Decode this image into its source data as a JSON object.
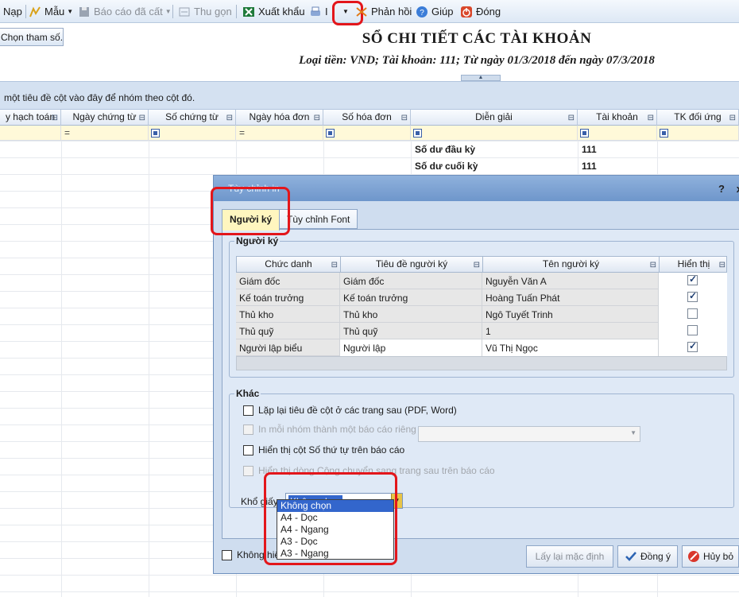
{
  "toolbar": {
    "nap": "Nạp",
    "mau": "Mẫu",
    "bao_cao_da_cat": "Báo cáo đã cất",
    "thu_gon": "Thu gọn",
    "xuat_khau": "Xuất khẩu",
    "in_label": "I",
    "phan_hoi": "Phản hồi",
    "giup": "Giúp",
    "dong": "Đóng"
  },
  "chon_tham_so": "Chọn tham số...",
  "report": {
    "title": "SỔ CHI TIẾT CÁC TÀI KHOẢN",
    "subtitle": "Loại tiền: VND; Tài khoản: 111; Từ ngày 01/3/2018 đến ngày 07/3/2018"
  },
  "group_panel_text": "một tiêu đề cột vào đây để nhóm theo cột đó.",
  "grid": {
    "columns": [
      "y hạch toán",
      "Ngày chứng từ",
      "Số chứng từ",
      "Ngày hóa đơn",
      "Số hóa đơn",
      "Diễn giải",
      "Tài khoản",
      "TK đối ứng"
    ],
    "rows": [
      {
        "dien_giai": "Số dư đầu kỳ",
        "tai_khoan": "111"
      },
      {
        "dien_giai": "Số dư cuối kỳ",
        "tai_khoan": "111"
      }
    ]
  },
  "dialog": {
    "title": "Tùy chỉnh in",
    "help": "?",
    "close": "x",
    "tabs": [
      "Người ký",
      "Tùy chỉnh Font"
    ],
    "signers_legend": "Người ký",
    "signer_columns": [
      "Chức danh",
      "Tiêu đề người ký",
      "Tên người ký",
      "Hiển thị"
    ],
    "signers": [
      {
        "chuc_danh": "Giám đốc",
        "tieu_de": "Giám đốc",
        "ten": "Nguyễn Văn A",
        "hien_thi": true
      },
      {
        "chuc_danh": "Kế toán trưởng",
        "tieu_de": "Kế toán trưởng",
        "ten": "Hoàng Tuấn Phát",
        "hien_thi": true
      },
      {
        "chuc_danh": "Thủ kho",
        "tieu_de": "Thủ kho",
        "ten": "Ngô Tuyết Trinh",
        "hien_thi": false
      },
      {
        "chuc_danh": "Thủ quỹ",
        "tieu_de": "Thủ quỹ",
        "ten": "1",
        "hien_thi": false
      },
      {
        "chuc_danh": "Người lập biểu",
        "tieu_de": "Người lập",
        "ten": "Vũ Thị Ngọc",
        "hien_thi": true
      }
    ],
    "other_legend": "Khác",
    "options": [
      "Lặp lại tiêu đề cột ở các trang sau (PDF, Word)",
      "In mỗi nhóm thành một báo cáo riêng",
      "Hiển thị cột Số thứ tự trên báo cáo",
      "Hiển thị dòng Cộng chuyển sang trang sau trên báo cáo"
    ],
    "kho_giay_label": "Khổ giấy",
    "kho_giay_value": "Không chọn",
    "kho_giay_options": [
      "Không chọn",
      "A4 - Dọc",
      "A4 - Ngang",
      "A3 - Dọc",
      "A3 - Ngang"
    ],
    "bottom_option": "Không hiển",
    "buttons": {
      "lay_lai": "Lấy lại mặc định",
      "dong_y": "Đồng ý",
      "huy_bo": "Hủy bỏ"
    }
  }
}
